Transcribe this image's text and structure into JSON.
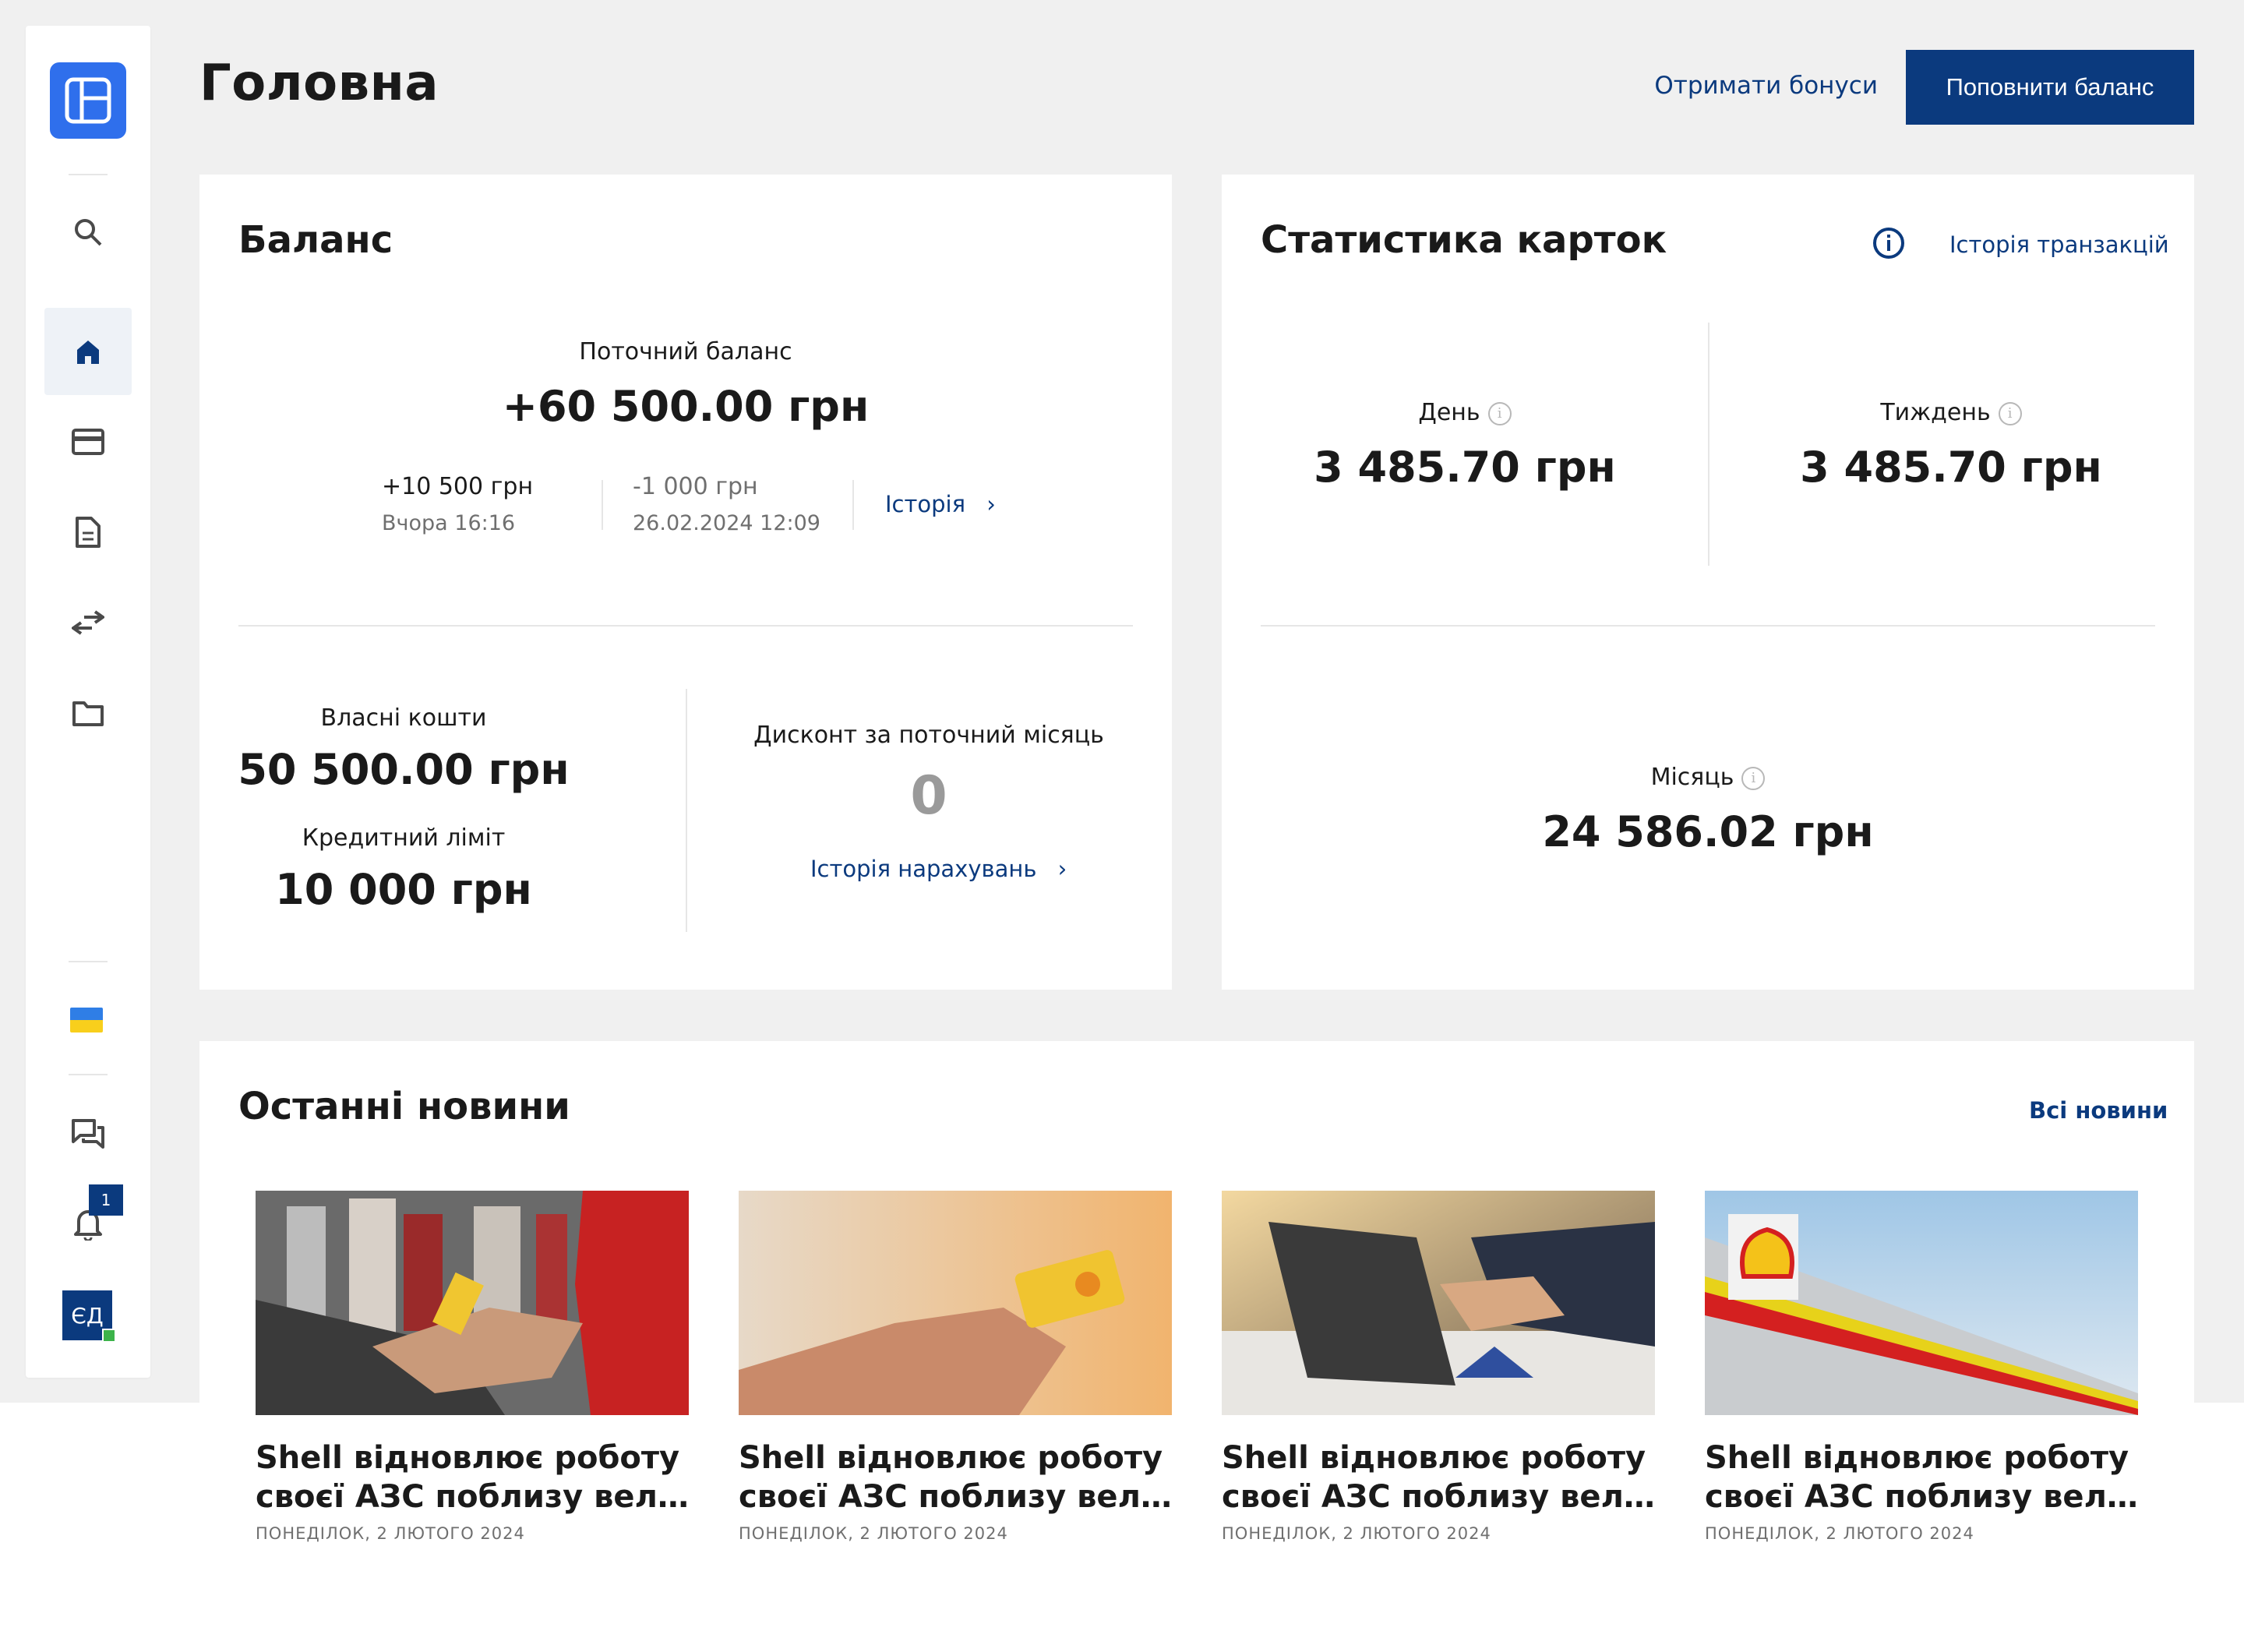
{
  "page": {
    "title": "Головна"
  },
  "header": {
    "bonus_link": "Отримати бонуси",
    "topup_button": "Поповнити баланс"
  },
  "sidebar": {
    "items": [
      {
        "name": "search",
        "icon": "search-icon"
      },
      {
        "name": "home",
        "icon": "home-icon",
        "active": true
      },
      {
        "name": "cards",
        "icon": "credit-card-icon"
      },
      {
        "name": "documents",
        "icon": "document-icon"
      },
      {
        "name": "transfers",
        "icon": "transfer-arrows-icon"
      },
      {
        "name": "files",
        "icon": "folder-icon"
      }
    ],
    "language_icon": "ukraine-flag-icon",
    "notifications_badge": "1",
    "user_initials": "ЄД"
  },
  "balance": {
    "title": "Баланс",
    "current_label": "Поточний баланс",
    "current_value": "+60 500.00 грн",
    "recent": [
      {
        "amount": "+10 500 грн",
        "date": "Вчора 16:16"
      },
      {
        "amount": "-1 000 грн",
        "date": "26.02.2024 12:09"
      }
    ],
    "history_link": "Історія",
    "own_funds_label": "Власні кошти",
    "own_funds_value": "50 500.00 грн",
    "credit_label": "Кредитний ліміт",
    "credit_value": "10 000 грн",
    "discount_label": "Дисконт за поточний місяць",
    "discount_value": "0",
    "accruals_link": "Історія нарахувань"
  },
  "stats": {
    "title": "Статистика карток",
    "transactions_link": "Історія транзакцій",
    "day_label": "День",
    "day_value": "3 485.70 грн",
    "week_label": "Тиждень",
    "week_value": "3 485.70 грн",
    "month_label": "Місяць",
    "month_value": "24 586.02 грн"
  },
  "news": {
    "title": "Останні новини",
    "all_link": "Всі новини",
    "items": [
      {
        "line1": "Shell відновлює роботу",
        "line2": "своєї АЗС поблизу вели...",
        "date": "ПОНЕДІЛОК, 2 ЛЮТОГО 2024"
      },
      {
        "line1": "Shell відновлює роботу",
        "line2": "своєї АЗС поблизу вели...",
        "date": "ПОНЕДІЛОК, 2 ЛЮТОГО 2024"
      },
      {
        "line1": "Shell відновлює роботу",
        "line2": "своєї АЗС поблизу вели...",
        "date": "ПОНЕДІЛОК, 2 ЛЮТОГО 2024"
      },
      {
        "line1": "Shell відновлює роботу",
        "line2": "своєї АЗС поблизу вели...",
        "date": "ПОНЕДІЛОК, 2 ЛЮТОГО 2024"
      }
    ]
  },
  "colors": {
    "brand_blue": "#0b3a7e",
    "logo_blue": "#2f6fec",
    "background": "#f0f0f0"
  }
}
